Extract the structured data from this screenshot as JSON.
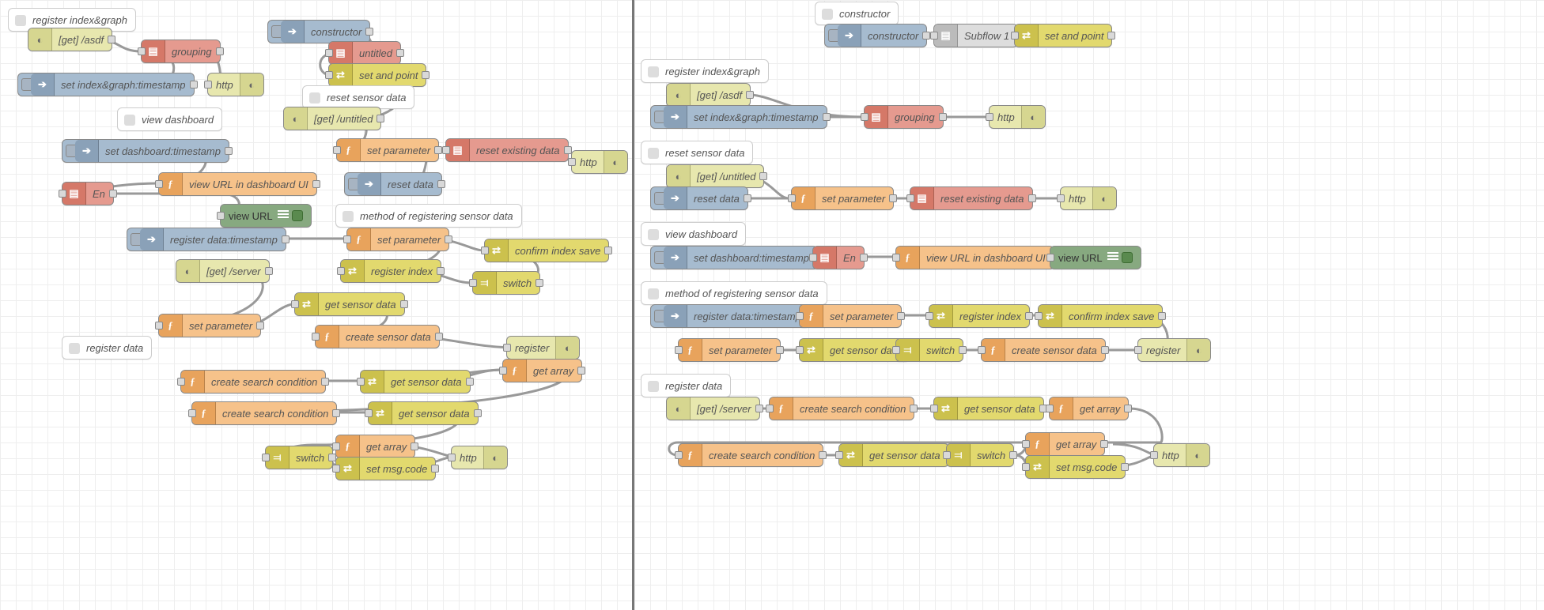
{
  "left": {
    "comments": {
      "c1": "register index&graph",
      "c2": "view dashboard",
      "c3": "reset sensor data",
      "c4": "register data",
      "c5": "method of registering sensor data"
    },
    "nodes": {
      "get_asdf": "[get] /asdf",
      "grouping": "grouping",
      "http1": "http",
      "set_index_ts": "set index&graph:timestamp",
      "constructor": "constructor",
      "untitled": "untitled",
      "set_and_point": "set and point",
      "get_untitled": "[get] /untitled",
      "set_parameter1": "set parameter",
      "reset_existing": "reset existing data",
      "http2": "http",
      "reset_data": "reset data",
      "set_dash_ts": "set dashboard:timestamp",
      "view_url_dash": "view URL in dashboard UI",
      "en": "En",
      "view_url": "view URL",
      "reg_data_ts": "register data:timestamp",
      "set_parameter2": "set parameter",
      "confirm_save": "confirm index save",
      "register_index": "register index",
      "switch1": "switch",
      "get_server": "[get] /server",
      "get_sensor1": "get sensor data",
      "set_parameter3": "set parameter",
      "create_sensor": "create sensor data",
      "register": "register",
      "get_array1": "get array",
      "create_search1": "create search condition",
      "get_sensor2": "get sensor data",
      "create_search2": "create search condition",
      "get_sensor3": "get sensor data",
      "switch2": "switch",
      "get_array2": "get array",
      "set_msg": "set msg.code",
      "http3": "http"
    }
  },
  "right": {
    "comments": {
      "rc0": "constructor",
      "rc1": "register index&graph",
      "rc2": "reset sensor data",
      "rc3": "view dashboard",
      "rc4": "method of registering sensor data",
      "rc5": "register data"
    },
    "nodes": {
      "r_constructor": "constructor",
      "r_subflow1": "Subflow 1",
      "r_set_and_point": "set and point",
      "r_get_asdf": "[get] /asdf",
      "r_set_index_ts": "set index&graph:timestamp",
      "r_grouping": "grouping",
      "r_http1": "http",
      "r_get_untitled": "[get] /untitled",
      "r_reset_data": "reset data",
      "r_set_param1": "set parameter",
      "r_reset_exist": "reset existing data",
      "r_http2": "http",
      "r_set_dash_ts": "set dashboard:timestamp",
      "r_en": "En",
      "r_view_url_dash": "view URL in dashboard UI",
      "r_view_url": "view URL",
      "r_reg_data_ts": "register data:timestamp",
      "r_set_param2": "set parameter",
      "r_register_index": "register index",
      "r_confirm_save": "confirm index save",
      "r_set_param3": "set parameter",
      "r_get_sensor1": "get sensor data",
      "r_switch1": "switch",
      "r_create_sensor": "create sensor data",
      "r_register": "register",
      "r_get_server": "[get] /server",
      "r_create_search1": "create search condition",
      "r_get_sensor2": "get sensor data",
      "r_get_array1": "get array",
      "r_create_search2": "create search condition",
      "r_get_sensor3": "get sensor data",
      "r_switch2": "switch",
      "r_get_array2": "get array",
      "r_set_msg": "set msg.code",
      "r_http3": "http"
    }
  }
}
